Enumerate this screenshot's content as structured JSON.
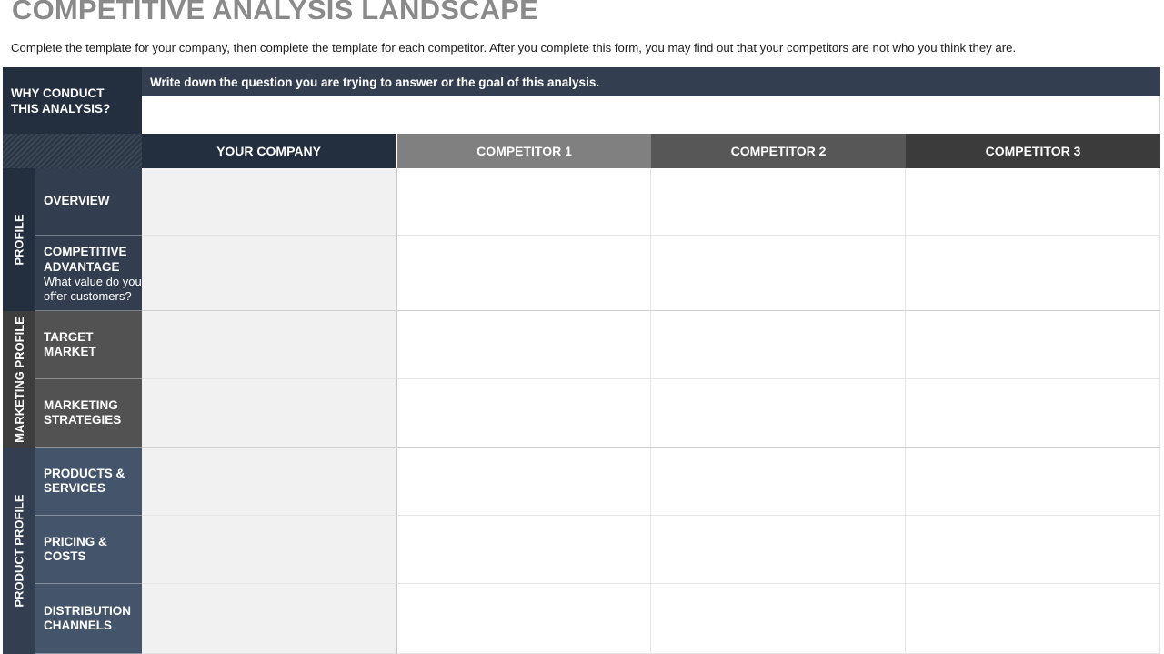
{
  "title": "COMPETITIVE ANALYSIS LANDSCAPE",
  "subtitle": "Complete the template for your company, then complete the template for each competitor. After you complete this form, you may find out that your competitors are not who you think they are.",
  "why": {
    "label_line1": "WHY CONDUCT",
    "label_line2": "THIS ANALYSIS?",
    "prompt": "Write down the question you are trying to answer or the goal of this analysis."
  },
  "columns": {
    "your_company": "YOUR COMPANY",
    "competitor1": "COMPETITOR 1",
    "competitor2": "COMPETITOR 2",
    "competitor3": "COMPETITOR 3"
  },
  "sections": {
    "profile": "PROFILE",
    "marketing": "MARKETING PROFILE",
    "product": "PRODUCT PROFILE"
  },
  "rows": {
    "overview": "OVERVIEW",
    "competitive_advantage_line1": "COMPETITIVE",
    "competitive_advantage_line2": "ADVANTAGE",
    "competitive_advantage_note": "What value do you offer customers?",
    "target_market_line1": "TARGET",
    "target_market_line2": "MARKET",
    "marketing_strategies_line1": "MARKETING",
    "marketing_strategies_line2": "STRATEGIES",
    "products_services_line1": "PRODUCTS &",
    "products_services_line2": "SERVICES",
    "pricing_costs_line1": "PRICING &",
    "pricing_costs_line2": "COSTS",
    "distribution_channels_line1": "DISTRIBUTION",
    "distribution_channels_line2": "CHANNELS"
  },
  "colors": {
    "dark_navy": "#232f3e",
    "slate": "#333f50",
    "profile_label": "#323d4f",
    "marketing_label": "#525252",
    "product_label": "#44546a",
    "competitor1_header": "#808080",
    "competitor2_header": "#575757",
    "competitor3_header": "#3b3b3b",
    "title_gray": "#8a8a8a"
  }
}
